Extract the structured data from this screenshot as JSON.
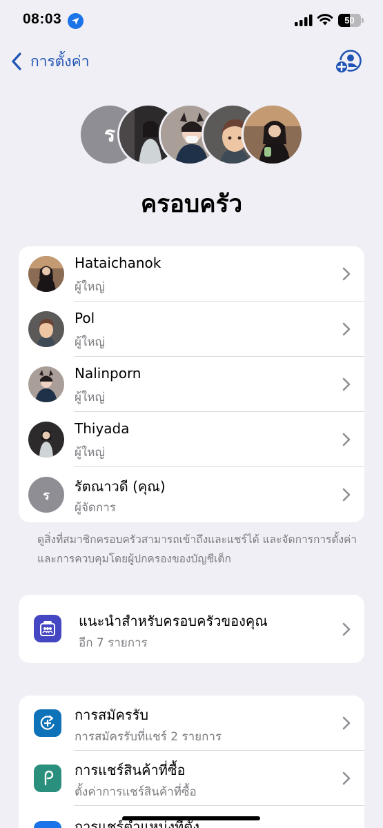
{
  "status": {
    "time": "08:03",
    "battery": 50
  },
  "nav": {
    "back_label": "การตั้งค่า"
  },
  "header": {
    "title": "ครอบครัว",
    "organizer_initial": "ร"
  },
  "members": [
    {
      "name": "Hataichanok",
      "role": "ผู้ใหญ่"
    },
    {
      "name": "Pol",
      "role": "ผู้ใหญ่"
    },
    {
      "name": "Nalinporn",
      "role": "ผู้ใหญ่"
    },
    {
      "name": "Thiyada",
      "role": "ผู้ใหญ่"
    },
    {
      "name": "รัตณาวดี (คุณ)",
      "role": "ผู้จัดการ",
      "initial": "ร"
    }
  ],
  "members_note": "ดูสิ่งที่สมาชิกครอบครัวสามารถเข้าถึงและแชร์ได้ และจัดการการตั้งค่าและการควบคุมโดยผู้ปกครองของบัญชีเด็ก",
  "recommendations": {
    "title": "แนะนำสำหรับครอบครัวของคุณ",
    "subtitle": "อีก 7 รายการ"
  },
  "features": [
    {
      "title": "การสมัครรับ",
      "subtitle": "การสมัครรับที่แชร์ 2 รายการ"
    },
    {
      "title": "การแชร์สินค้าที่ซื้อ",
      "subtitle": "ตั้งค่าการแชร์สินค้าที่ซื้อ"
    },
    {
      "title": "การแชร์ตำแหน่งที่ตั้ง"
    }
  ],
  "colors": {
    "accent": "#1f53b5",
    "recommend_icon": "#4447c1",
    "subscriptions_icon": "#0e72b8",
    "purchase_icon": "#2a8f7c",
    "location_icon": "#1a73e8"
  }
}
